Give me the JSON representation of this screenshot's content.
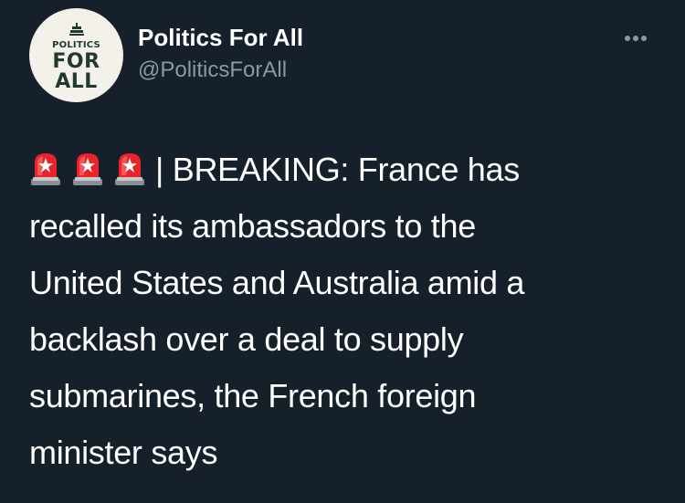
{
  "account": {
    "display_name": "Politics For All",
    "handle": "@PoliticsForAll",
    "avatar_lines": [
      "POLITICS",
      "FOR",
      "ALL"
    ]
  },
  "menu": {
    "icon": "more-horizontal-icon"
  },
  "tweet": {
    "emoji": [
      "police-car-light",
      "police-car-light",
      "police-car-light"
    ],
    "lines": [
      "| BREAKING: France has",
      "recalled its ambassadors to the",
      "United States and Australia amid a",
      "backlash over a deal to supply",
      "submarines, the French foreign",
      "minister says"
    ]
  },
  "colors": {
    "background": "#15202b",
    "text": "#ffffff",
    "secondary_text": "#8b98a5",
    "avatar_bg": "#f3f1ea",
    "avatar_text": "#1f3b2e",
    "siren_red": "#e8232a"
  }
}
